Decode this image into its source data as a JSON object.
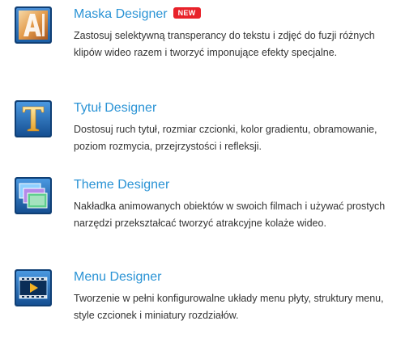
{
  "features": [
    {
      "title": "Maska Designer",
      "badge": "NEW",
      "icon": "mask-designer-icon",
      "description": "Zastosuj selektywną transperancy do tekstu i zdjęć do fuzji różnych klipów wideo razem i tworzyć imponujące efekty specjalne."
    },
    {
      "title": "Tytuł Designer",
      "icon": "title-designer-icon",
      "description": "Dostosuj ruch tytuł, rozmiar czcionki, kolor gradientu, obramowanie, poziom rozmycia, przejrzystości i refleksji."
    },
    {
      "title": "Theme Designer",
      "icon": "theme-designer-icon",
      "description": "Nakładka animowanych obiektów w swoich filmach i używać prostych narzędzi przekształcać tworzyć atrakcyjne kolaże wideo."
    },
    {
      "title": "Menu Designer",
      "icon": "menu-designer-icon",
      "description": "Tworzenie w pełni konfigurowalne układy menu płyty, struktury menu, style czcionek i miniatury rozdziałów."
    }
  ],
  "colors": {
    "title": "#2a93d5",
    "text": "#333333",
    "badge_bg": "#e8222a",
    "icon_blue": "#1f6db5"
  }
}
